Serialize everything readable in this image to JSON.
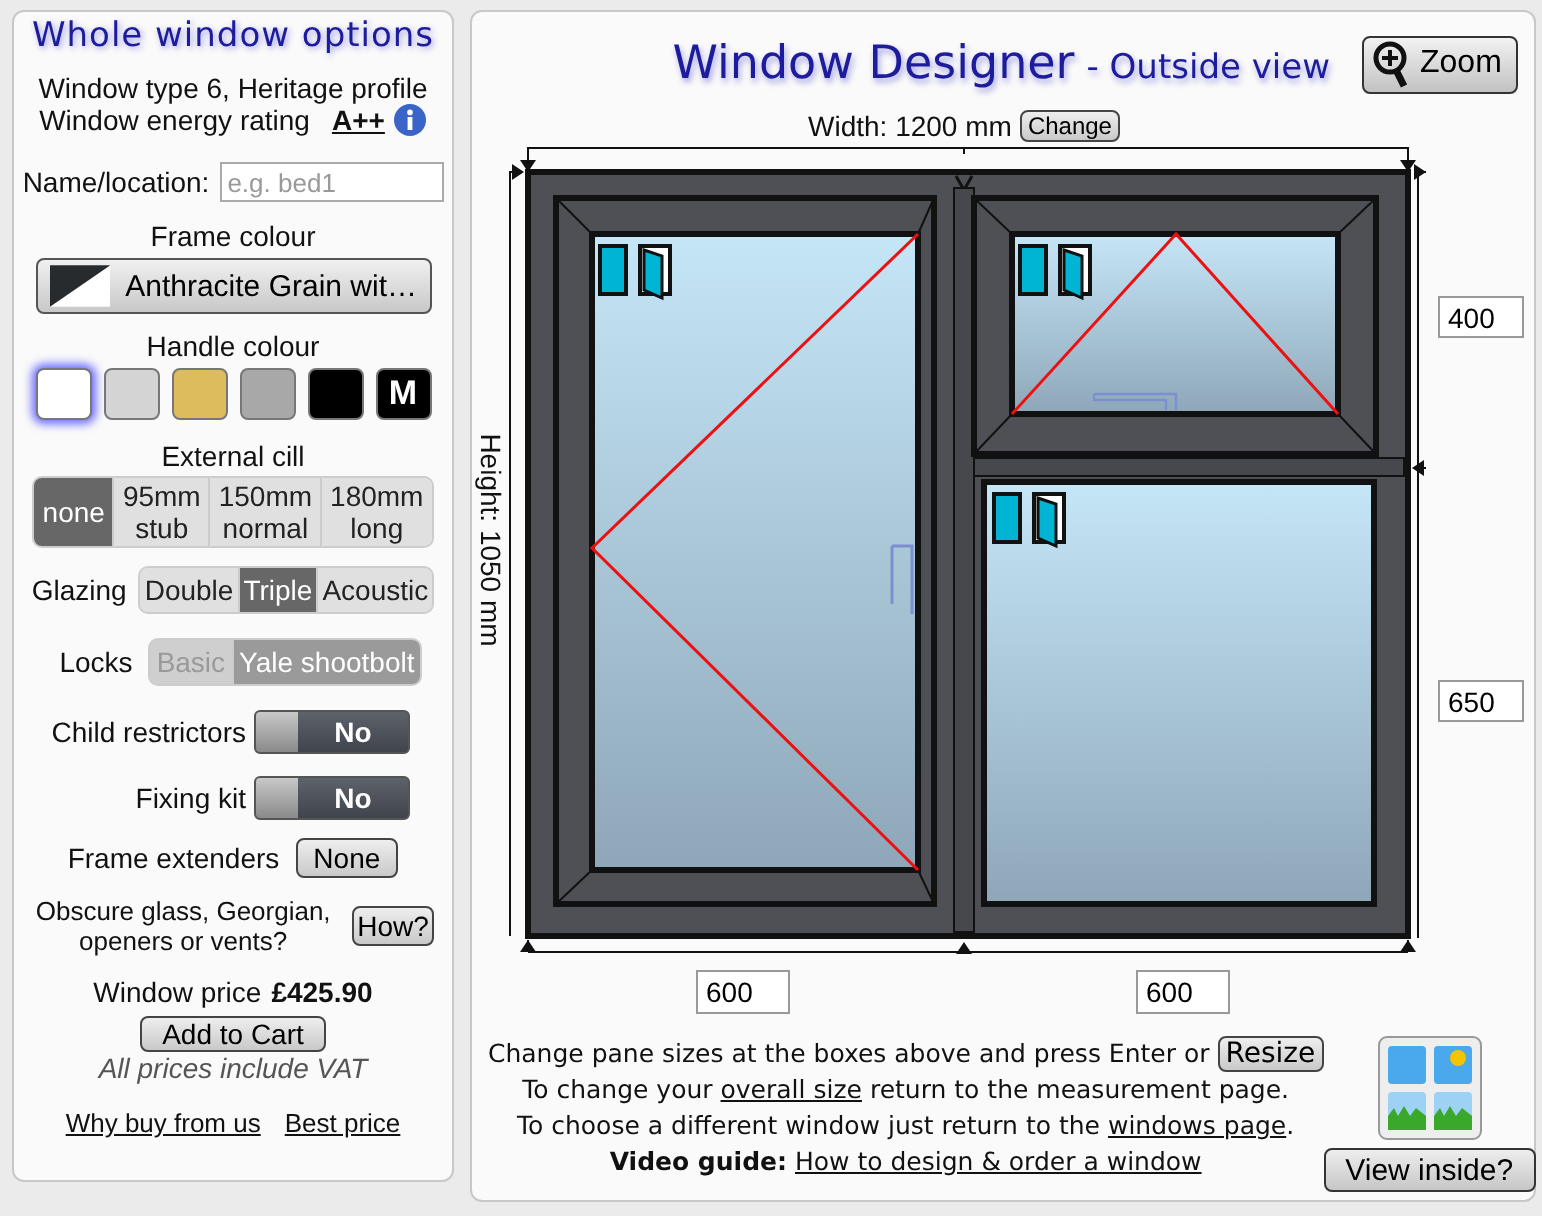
{
  "sidebar": {
    "title": "Whole window options",
    "window_type": "Window type 6, Heritage profile",
    "energy_label": "Window energy rating",
    "energy_rating": "A++",
    "name_label": "Name/location:",
    "name_placeholder": "e.g. bed1",
    "frame_label": "Frame colour",
    "frame_value": "Anthracite Grain wit…",
    "handle_label": "Handle colour",
    "handle_colours": [
      {
        "color": "#ffffff",
        "selected": true
      },
      {
        "color": "#d4d4d4",
        "selected": false
      },
      {
        "color": "#dcbc5c",
        "selected": false
      },
      {
        "color": "#a8a8a8",
        "selected": false
      },
      {
        "color": "#000000",
        "selected": false
      },
      {
        "color": "#000000",
        "selected": false,
        "label": "M"
      }
    ],
    "cill_label": "External cill",
    "cill_options": [
      {
        "label": "none",
        "selected": true
      },
      {
        "label": "95mm",
        "sub": "stub",
        "selected": false
      },
      {
        "label": "150mm",
        "sub": "normal",
        "selected": false
      },
      {
        "label": "180mm",
        "sub": "long",
        "selected": false
      }
    ],
    "glazing_label": "Glazing",
    "glazing_options": [
      {
        "label": "Double",
        "selected": false
      },
      {
        "label": "Triple",
        "selected": true
      },
      {
        "label": "Acoustic",
        "selected": false
      }
    ],
    "locks_label": "Locks",
    "locks_disabled": true,
    "locks_options": [
      {
        "label": "Basic",
        "selected": false
      },
      {
        "label": "Yale shootbolt",
        "selected": true
      }
    ],
    "toggles": [
      {
        "label": "Child restrictors",
        "value": "No",
        "on": false
      },
      {
        "label": "Fixing kit",
        "value": "No",
        "on": false
      }
    ],
    "extenders_label": "Frame extenders",
    "extenders_value": "None",
    "obscure_text": "Obscure glass, Georgian, openers or vents?",
    "how_button": "How?",
    "price_label": "Window price",
    "price": "£425.90",
    "cart_button": "Add to Cart",
    "vat_note": "All prices include VAT",
    "links": [
      "Why buy from us",
      "Best price"
    ]
  },
  "designer": {
    "title": "Window Designer",
    "subtitle": "- Outside view",
    "zoom_button": "Zoom",
    "width_label": "Width: 1200 mm",
    "change_button": "Change",
    "height_label": "Height: 1050 mm",
    "right_sizes": [
      "400",
      "650"
    ],
    "bottom_sizes": [
      "600",
      "600"
    ],
    "help": {
      "resize_text": "Change pane sizes at the boxes above and press Enter or",
      "resize_button": "Resize",
      "size_before": "To change your",
      "size_link": "overall size",
      "size_after": "return to the measurement page.",
      "window_before": "To choose a different window just return to the",
      "window_link": "windows page",
      "window_after": ".",
      "video_label": "Video guide:",
      "video_link": "How to design & order a window"
    },
    "view_inside_button": "View inside?"
  }
}
